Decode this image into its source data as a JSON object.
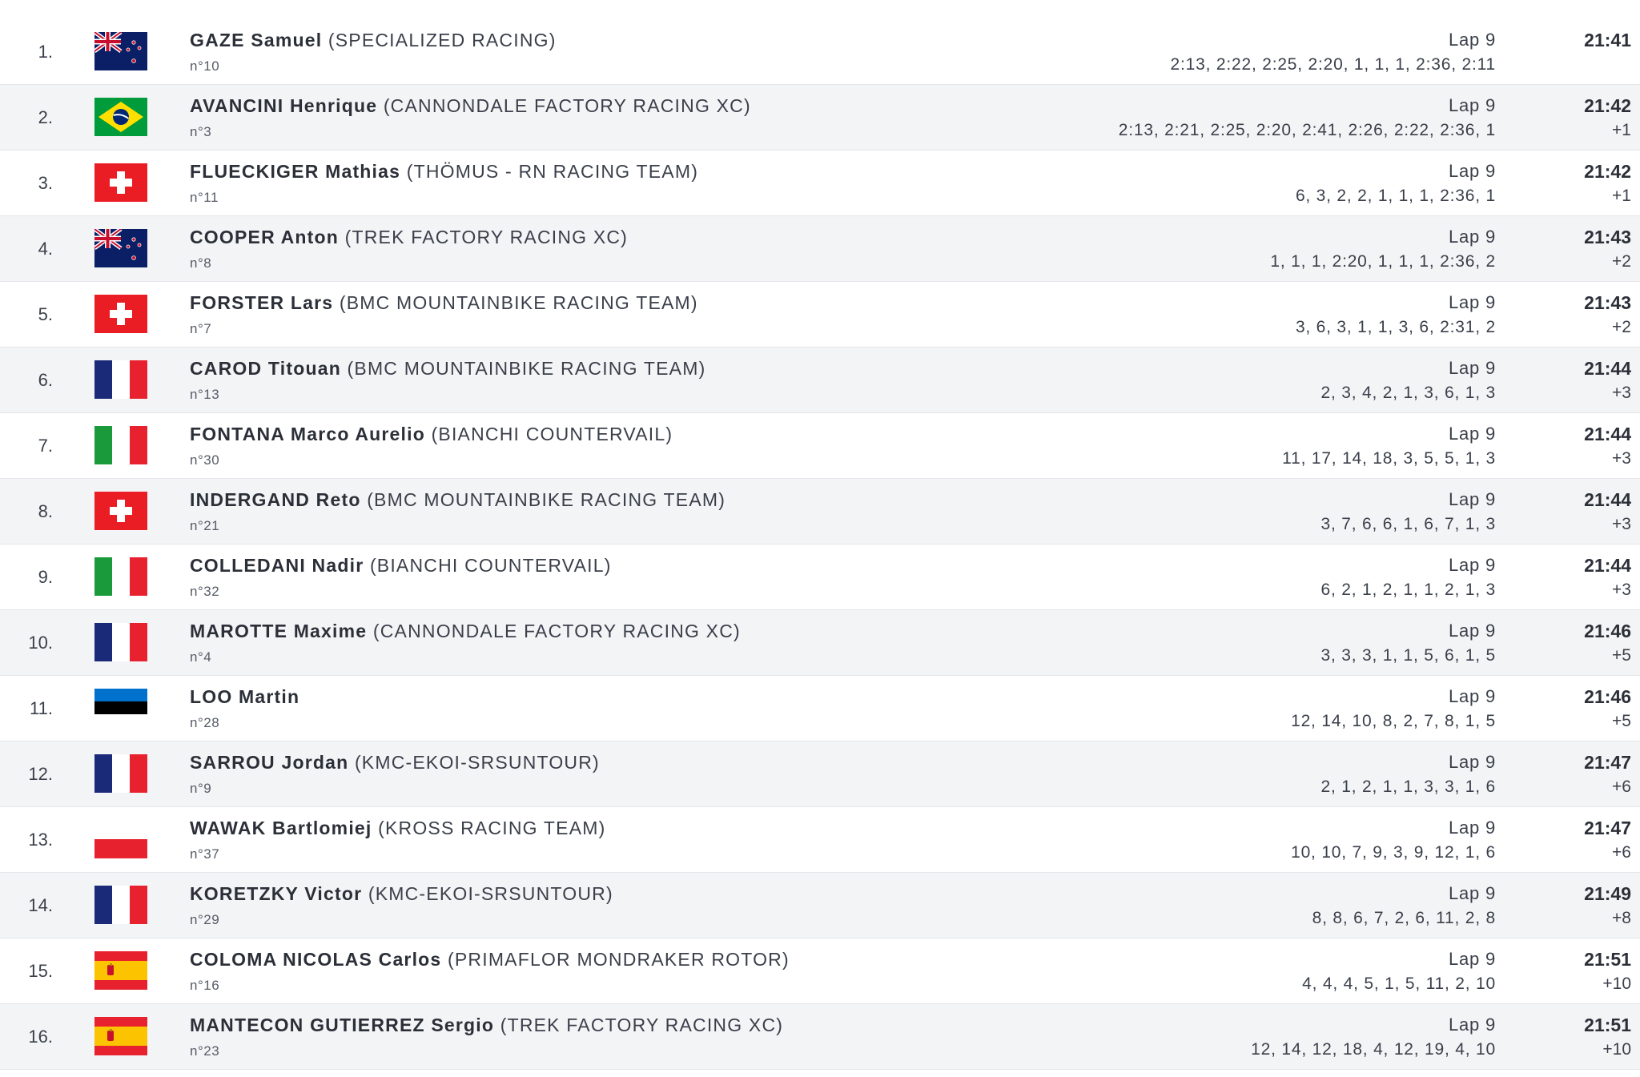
{
  "rows": [
    {
      "pos": "1.",
      "flag": "NZL",
      "rider": "GAZE Samuel",
      "team": "(SPECIALIZED RACING)",
      "bib": "n°10",
      "lap": "Lap 9",
      "splits": "2:13, 2:22, 2:25, 2:20, 1, 1, 1, 2:36, 2:11",
      "time": "21:41",
      "gap": ""
    },
    {
      "pos": "2.",
      "flag": "BRA",
      "rider": "AVANCINI Henrique",
      "team": "(CANNONDALE FACTORY RACING XC)",
      "bib": "n°3",
      "lap": "Lap 9",
      "splits": "2:13, 2:21, 2:25, 2:20, 2:41, 2:26, 2:22, 2:36, 1",
      "time": "21:42",
      "gap": "+1"
    },
    {
      "pos": "3.",
      "flag": "SUI",
      "rider": "FLUECKIGER Mathias",
      "team": "(THÖMUS - RN RACING TEAM)",
      "bib": "n°11",
      "lap": "Lap 9",
      "splits": "6, 3, 2, 2, 1, 1, 1, 2:36, 1",
      "time": "21:42",
      "gap": "+1"
    },
    {
      "pos": "4.",
      "flag": "NZL",
      "rider": "COOPER Anton",
      "team": "(TREK FACTORY RACING XC)",
      "bib": "n°8",
      "lap": "Lap 9",
      "splits": "1, 1, 1, 2:20, 1, 1, 1, 2:36, 2",
      "time": "21:43",
      "gap": "+2"
    },
    {
      "pos": "5.",
      "flag": "SUI",
      "rider": "FORSTER Lars",
      "team": "(BMC MOUNTAINBIKE RACING TEAM)",
      "bib": "n°7",
      "lap": "Lap 9",
      "splits": "3, 6, 3, 1, 1, 3, 6, 2:31, 2",
      "time": "21:43",
      "gap": "+2"
    },
    {
      "pos": "6.",
      "flag": "FRA",
      "rider": "CAROD Titouan",
      "team": "(BMC MOUNTAINBIKE RACING TEAM)",
      "bib": "n°13",
      "lap": "Lap 9",
      "splits": "2, 3, 4, 2, 1, 3, 6, 1, 3",
      "time": "21:44",
      "gap": "+3"
    },
    {
      "pos": "7.",
      "flag": "ITA",
      "rider": "FONTANA Marco Aurelio",
      "team": "(BIANCHI COUNTERVAIL)",
      "bib": "n°30",
      "lap": "Lap 9",
      "splits": "11, 17, 14, 18, 3, 5, 5, 1, 3",
      "time": "21:44",
      "gap": "+3"
    },
    {
      "pos": "8.",
      "flag": "SUI",
      "rider": "INDERGAND Reto",
      "team": "(BMC MOUNTAINBIKE RACING TEAM)",
      "bib": "n°21",
      "lap": "Lap 9",
      "splits": "3, 7, 6, 6, 1, 6, 7, 1, 3",
      "time": "21:44",
      "gap": "+3"
    },
    {
      "pos": "9.",
      "flag": "ITA",
      "rider": "COLLEDANI Nadir",
      "team": "(BIANCHI COUNTERVAIL)",
      "bib": "n°32",
      "lap": "Lap 9",
      "splits": "6, 2, 1, 2, 1, 1, 2, 1, 3",
      "time": "21:44",
      "gap": "+3"
    },
    {
      "pos": "10.",
      "flag": "FRA",
      "rider": "MAROTTE Maxime",
      "team": "(CANNONDALE FACTORY RACING XC)",
      "bib": "n°4",
      "lap": "Lap 9",
      "splits": "3, 3, 3, 1, 1, 5, 6, 1, 5",
      "time": "21:46",
      "gap": "+5"
    },
    {
      "pos": "11.",
      "flag": "EST",
      "rider": "LOO Martin",
      "team": "",
      "bib": "n°28",
      "lap": "Lap 9",
      "splits": "12, 14, 10, 8, 2, 7, 8, 1, 5",
      "time": "21:46",
      "gap": "+5"
    },
    {
      "pos": "12.",
      "flag": "FRA",
      "rider": "SARROU Jordan",
      "team": "(KMC-EKOI-SRSUNTOUR)",
      "bib": "n°9",
      "lap": "Lap 9",
      "splits": "2, 1, 2, 1, 1, 3, 3, 1, 6",
      "time": "21:47",
      "gap": "+6"
    },
    {
      "pos": "13.",
      "flag": "POL",
      "rider": "WAWAK Bartlomiej",
      "team": "(KROSS RACING TEAM)",
      "bib": "n°37",
      "lap": "Lap 9",
      "splits": "10, 10, 7, 9, 3, 9, 12, 1, 6",
      "time": "21:47",
      "gap": "+6"
    },
    {
      "pos": "14.",
      "flag": "FRA",
      "rider": "KORETZKY Victor",
      "team": "(KMC-EKOI-SRSUNTOUR)",
      "bib": "n°29",
      "lap": "Lap 9",
      "splits": "8, 8, 6, 7, 2, 6, 11, 2, 8",
      "time": "21:49",
      "gap": "+8"
    },
    {
      "pos": "15.",
      "flag": "ESP",
      "rider": "COLOMA NICOLAS Carlos",
      "team": "(PRIMAFLOR MONDRAKER ROTOR)",
      "bib": "n°16",
      "lap": "Lap 9",
      "splits": "4, 4, 4, 5, 1, 5, 11, 2, 10",
      "time": "21:51",
      "gap": "+10"
    },
    {
      "pos": "16.",
      "flag": "ESP",
      "rider": "MANTECON GUTIERREZ Sergio",
      "team": "(TREK FACTORY RACING XC)",
      "bib": "n°23",
      "lap": "Lap 9",
      "splits": "12, 14, 12, 18, 4, 12, 19, 4, 10",
      "time": "21:51",
      "gap": "+10"
    }
  ]
}
